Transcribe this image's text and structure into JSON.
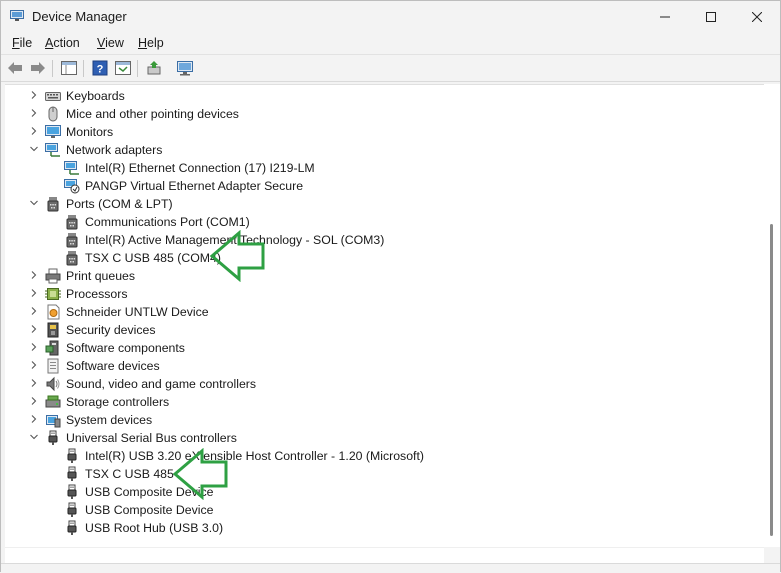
{
  "window": {
    "title": "Device Manager"
  },
  "menu": {
    "file": "File",
    "action": "Action",
    "view": "View",
    "help": "Help"
  },
  "tree": [
    {
      "label": "Keyboards",
      "level": 0,
      "expanded": false,
      "icon": "keyboard-icon"
    },
    {
      "label": "Mice and other pointing devices",
      "level": 0,
      "expanded": false,
      "icon": "mouse-icon"
    },
    {
      "label": "Monitors",
      "level": 0,
      "expanded": false,
      "icon": "monitor-icon"
    },
    {
      "label": "Network adapters",
      "level": 0,
      "expanded": true,
      "icon": "network-icon"
    },
    {
      "label": "Intel(R) Ethernet Connection (17) I219-LM",
      "level": 1,
      "icon": "network-adapter-icon"
    },
    {
      "label": "PANGP Virtual Ethernet Adapter Secure",
      "level": 1,
      "icon": "network-adapter-disabled-icon"
    },
    {
      "label": "Ports (COM & LPT)",
      "level": 0,
      "expanded": true,
      "icon": "port-icon"
    },
    {
      "label": "Communications Port (COM1)",
      "level": 1,
      "icon": "port-icon"
    },
    {
      "label": "Intel(R) Active Management Technology - SOL (COM3)",
      "level": 1,
      "icon": "port-icon"
    },
    {
      "label": "TSX C USB 485 (COM4)",
      "level": 1,
      "icon": "port-icon"
    },
    {
      "label": "Print queues",
      "level": 0,
      "expanded": false,
      "icon": "printer-icon"
    },
    {
      "label": "Processors",
      "level": 0,
      "expanded": false,
      "icon": "processor-icon"
    },
    {
      "label": "Schneider UNTLW Device",
      "level": 0,
      "expanded": false,
      "icon": "schneider-device-icon"
    },
    {
      "label": "Security devices",
      "level": 0,
      "expanded": false,
      "icon": "security-icon"
    },
    {
      "label": "Software components",
      "level": 0,
      "expanded": false,
      "icon": "software-components-icon"
    },
    {
      "label": "Software devices",
      "level": 0,
      "expanded": false,
      "icon": "software-devices-icon"
    },
    {
      "label": "Sound, video and game controllers",
      "level": 0,
      "expanded": false,
      "icon": "sound-icon"
    },
    {
      "label": "Storage controllers",
      "level": 0,
      "expanded": false,
      "icon": "storage-icon"
    },
    {
      "label": "System devices",
      "level": 0,
      "expanded": false,
      "icon": "system-devices-icon"
    },
    {
      "label": "Universal Serial Bus controllers",
      "level": 0,
      "expanded": true,
      "icon": "usb-icon"
    },
    {
      "label": "Intel(R) USB 3.20 eXtensible Host Controller - 1.20 (Microsoft)",
      "level": 1,
      "icon": "usb-icon"
    },
    {
      "label": "TSX C USB 485",
      "level": 1,
      "icon": "usb-icon"
    },
    {
      "label": "USB Composite Device",
      "level": 1,
      "icon": "usb-icon"
    },
    {
      "label": "USB Composite Device",
      "level": 1,
      "icon": "usb-icon"
    },
    {
      "label": "USB Root Hub (USB 3.0)",
      "level": 1,
      "icon": "usb-icon"
    }
  ],
  "colors": {
    "annotation_arrow": "#2ea043",
    "selection_accent": "#0067c0"
  }
}
